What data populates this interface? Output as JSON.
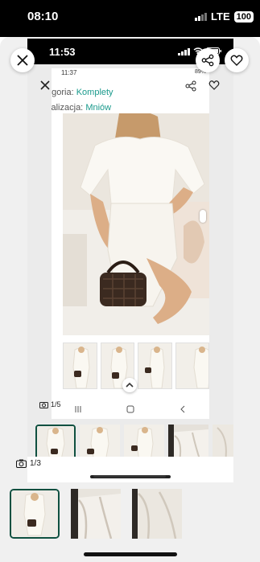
{
  "outer_status": {
    "time": "08:10",
    "network": "LTE",
    "battery": "100"
  },
  "inner2_status": {
    "time": "11:53"
  },
  "inner3_status": {
    "time": "11:37",
    "indicators": "89%"
  },
  "product": {
    "category_label": "egoria:",
    "category_value": "Komplety",
    "location_label": "kalizacja:",
    "location_value": "Mniów"
  },
  "counters": {
    "outer": "1/3",
    "inner": "1/5"
  },
  "icons": {
    "close": "close-icon",
    "share": "share-icon",
    "heart": "heart-icon",
    "camera": "camera-icon",
    "chevron_up": "chevron-up-icon"
  },
  "colors": {
    "accent": "#0f5040",
    "link": "#1a9a8c"
  }
}
